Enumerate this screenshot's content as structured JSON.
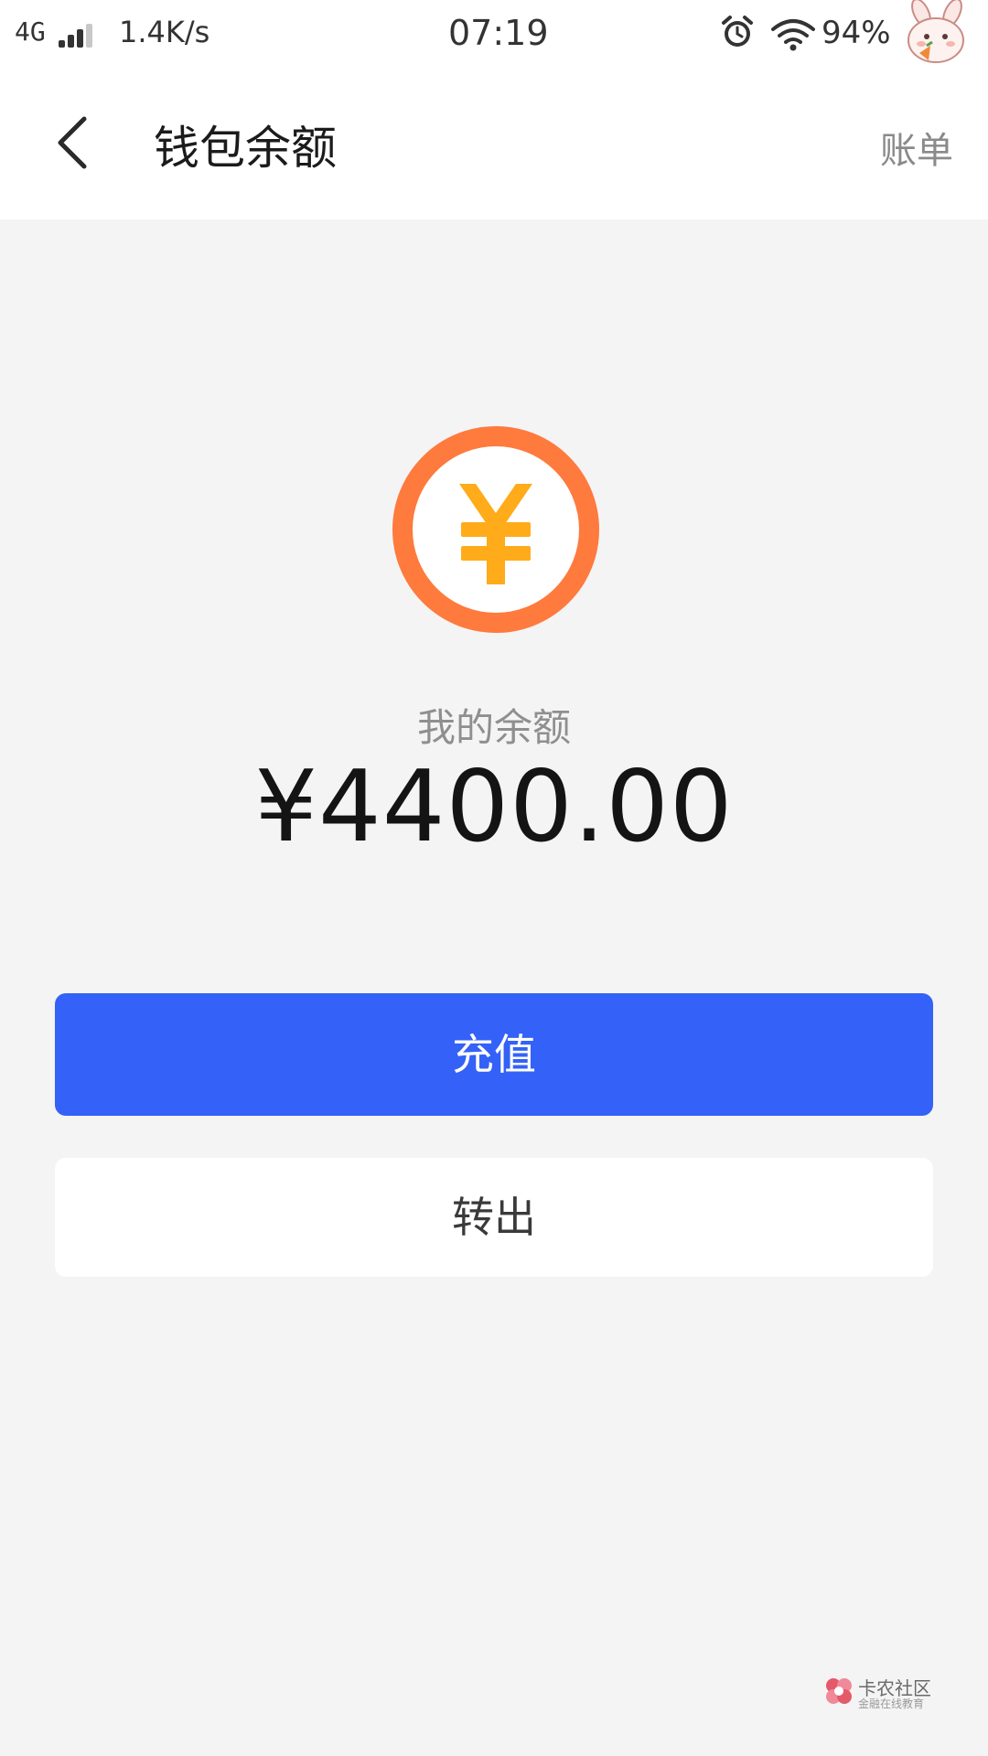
{
  "status_bar": {
    "network": "4G",
    "speed": "1.4K/s",
    "time": "07:19",
    "battery": "94%",
    "icons": [
      "signal-icon",
      "alarm-icon",
      "wifi-icon",
      "avatar-icon"
    ]
  },
  "header": {
    "title": "钱包余额",
    "right_link": "账单",
    "back_icon": "chevron-left-icon"
  },
  "wallet": {
    "icon": "yuan-coin-icon",
    "label": "我的余额",
    "amount": "¥4400.00"
  },
  "actions": {
    "recharge_label": "充值",
    "withdraw_label": "转出"
  },
  "watermark": {
    "title": "卡农社区",
    "subtitle": "金融在线教育"
  },
  "colors": {
    "primary": "#3461f7",
    "coin_ring": "#ff7a3d",
    "coin_symbol": "#ffab1a",
    "background": "#f4f4f4"
  }
}
